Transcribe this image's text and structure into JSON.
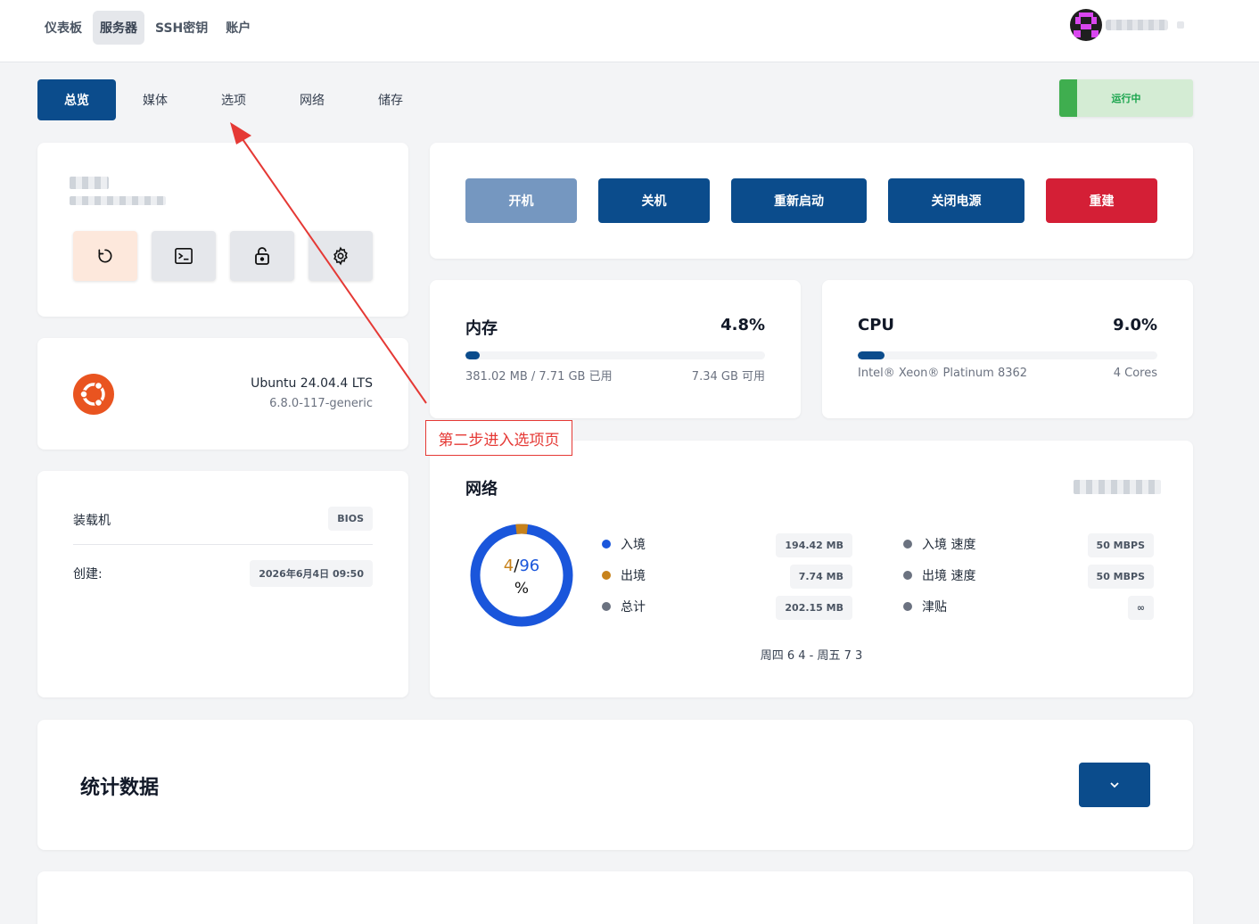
{
  "nav": {
    "items": [
      "仪表板",
      "服务器",
      "SSH密钥",
      "账户"
    ]
  },
  "tabs": [
    "总览",
    "媒体",
    "选项",
    "网络",
    "储存"
  ],
  "status": "运行中",
  "power": {
    "buttons": [
      "开机",
      "关机",
      "重新启动",
      "关闭电源",
      "重建"
    ]
  },
  "os": {
    "name": "Ubuntu 24.04.4 LTS",
    "kernel": "6.8.0-117-generic"
  },
  "boot": {
    "label": "装载机",
    "value": "BIOS",
    "created_label": "创建:",
    "created_value": "2026年6月4日 09:50"
  },
  "memory": {
    "title": "内存",
    "percent": "4.8%",
    "percent_value": 4.8,
    "used": "381.02 MB / 7.71 GB 已用",
    "available": "7.34 GB 可用"
  },
  "cpu": {
    "title": "CPU",
    "percent": "9.0%",
    "percent_value": 9.0,
    "model": "Intel® Xeon® Platinum 8362",
    "cores": "4 Cores"
  },
  "network": {
    "title": "网络",
    "donut_used": "4",
    "donut_sep": "/",
    "donut_total": "96",
    "donut_unit": "%",
    "donut_fraction": 0.04,
    "stats": [
      {
        "label": "入境",
        "value": "194.42 MB",
        "color": "#1a56db"
      },
      {
        "label": "出境",
        "value": "7.74 MB",
        "color": "#c7821b"
      },
      {
        "label": "总计",
        "value": "202.15 MB",
        "color": "#6b7280"
      }
    ],
    "speeds": [
      {
        "label": "入境 速度",
        "value": "50 MBPS"
      },
      {
        "label": "出境 速度",
        "value": "50 MBPS"
      },
      {
        "label": "津贴",
        "value": "∞"
      }
    ],
    "range": "周四 6 4 - 周五 7 3"
  },
  "stats_section": {
    "title": "统计数据"
  },
  "annotation": {
    "text": "第二步进入选项页"
  },
  "colors": {
    "primary": "#0b4c8c",
    "danger": "#d41f36",
    "success": "#3fae4f",
    "annotation": "#e53935"
  }
}
